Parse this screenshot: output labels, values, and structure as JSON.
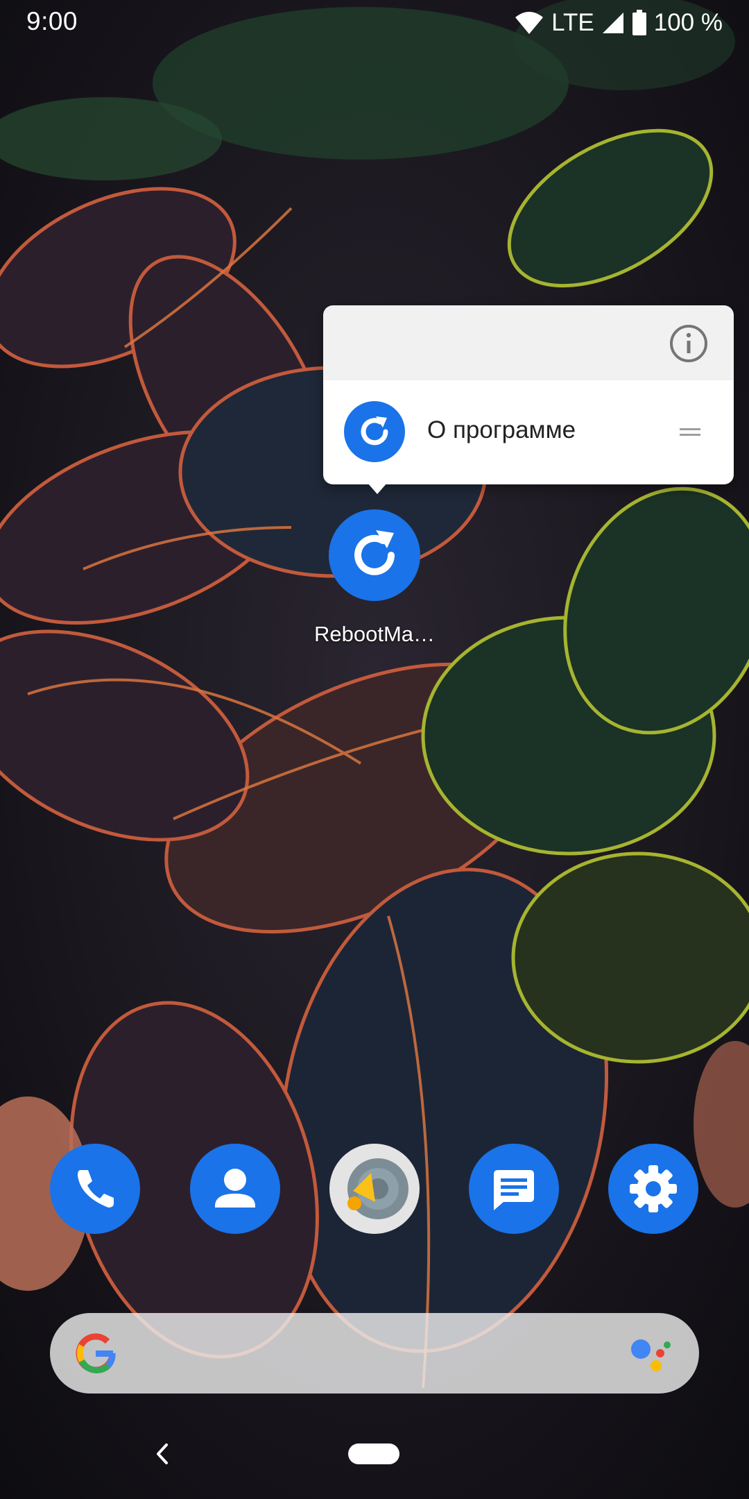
{
  "status_bar": {
    "time": "9:00",
    "network": "LTE",
    "battery": "100 %",
    "icons": [
      "wifi-icon",
      "cell-signal-icon",
      "battery-icon"
    ]
  },
  "shortcut_popup": {
    "info_icon": "info-icon",
    "item": {
      "label": "О программе",
      "icon": "reboot-app-icon",
      "handle_icon": "drag-handle-icon"
    }
  },
  "home": {
    "app": {
      "label": "RebootMa…",
      "icon": "reboot-app-icon"
    }
  },
  "dock": {
    "apps": [
      {
        "icon": "phone-icon"
      },
      {
        "icon": "contacts-icon"
      },
      {
        "icon": "speaker-app-icon"
      },
      {
        "icon": "messages-icon"
      },
      {
        "icon": "settings-icon"
      }
    ]
  },
  "search": {
    "logo": "google-logo",
    "assistant": "assistant-icon"
  },
  "nav": {
    "back": "back-icon",
    "home": "home-pill"
  },
  "colors": {
    "accent_blue": "#1a73e8",
    "popup_header": "#f1f1f1",
    "popup_body": "#ffffff"
  }
}
